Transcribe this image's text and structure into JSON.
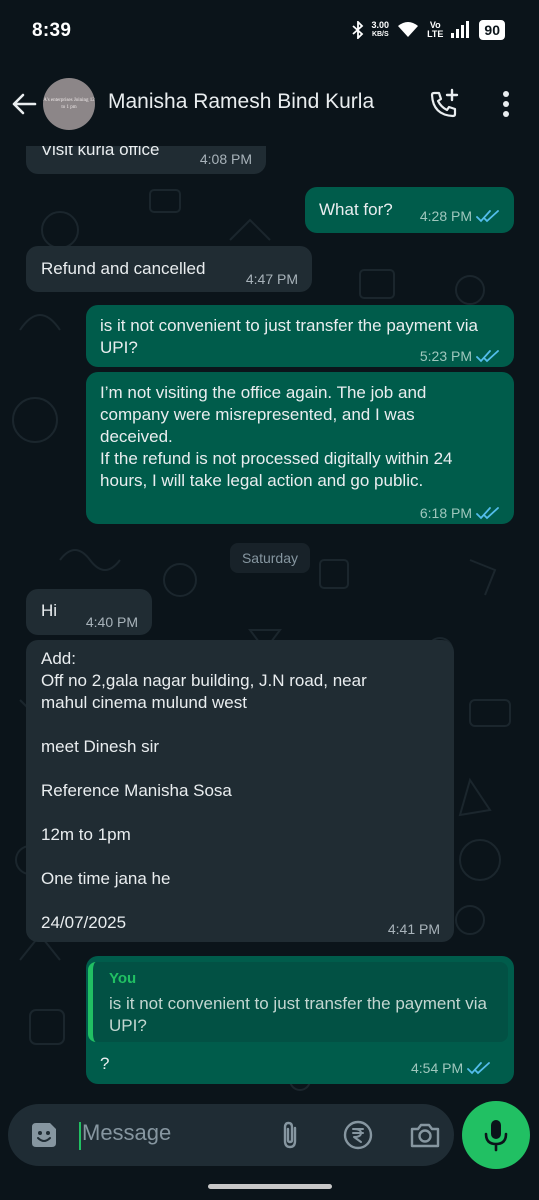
{
  "status_bar": {
    "time": "8:39",
    "net_speed_value": "3.00",
    "net_speed_unit": "KB/S",
    "volte_top": "Vo",
    "volte_bottom": "LTE",
    "battery": "90"
  },
  "header": {
    "contact_name": "Manisha Ramesh Bind Kurla",
    "avatar_text": "A's enterprises Joining 12 to 1 pm"
  },
  "messages": [
    {
      "direction": "incoming",
      "text": "Visit kurla office",
      "time": "4:08 PM"
    },
    {
      "direction": "outgoing",
      "text": "What for?",
      "time": "4:28 PM",
      "status": "read"
    },
    {
      "direction": "incoming",
      "text": "Refund and cancelled",
      "time": "4:47 PM"
    },
    {
      "direction": "outgoing",
      "text": "is it not convenient to just transfer the payment via UPI?",
      "time": "5:23 PM",
      "status": "read"
    },
    {
      "direction": "outgoing",
      "text": "I’m not visiting the office again. The job and company were misrepresented, and I was deceived.\nIf the refund is not processed digitally within 24 hours, I will take legal action and go public.",
      "time": "6:18 PM",
      "status": "read"
    },
    {
      "direction": "incoming",
      "text": "Hi",
      "time": "4:40 PM"
    },
    {
      "direction": "incoming",
      "text": "Add:\nOff no 2,gala nagar building, J.N road, near mahul cinema mulund west\n\nmeet Dinesh sir\n\nReference Manisha Sosa\n\n12m to 1pm\n\nOne time jana he\n\n24/07/2025",
      "time": "4:41 PM"
    },
    {
      "direction": "outgoing",
      "text": "?",
      "time": "4:54 PM",
      "status": "read",
      "quote": {
        "author": "You",
        "text": "is it not convenient to just transfer the payment via UPI?"
      }
    }
  ],
  "date_separator": "Saturday",
  "input": {
    "placeholder": "Message"
  },
  "icons": {
    "back": "arrow-left-icon",
    "call": "add-call-icon",
    "menu": "more-vertical-icon",
    "emoji": "sticker-icon",
    "attach": "paperclip-icon",
    "payment": "rupee-icon",
    "camera": "camera-icon",
    "mic": "mic-icon"
  },
  "colors": {
    "background": "#0b141a",
    "incoming_bubble": "#202c33",
    "outgoing_bubble": "#005c4b",
    "accent_green": "#21c063",
    "read_tick": "#53bdeb"
  }
}
